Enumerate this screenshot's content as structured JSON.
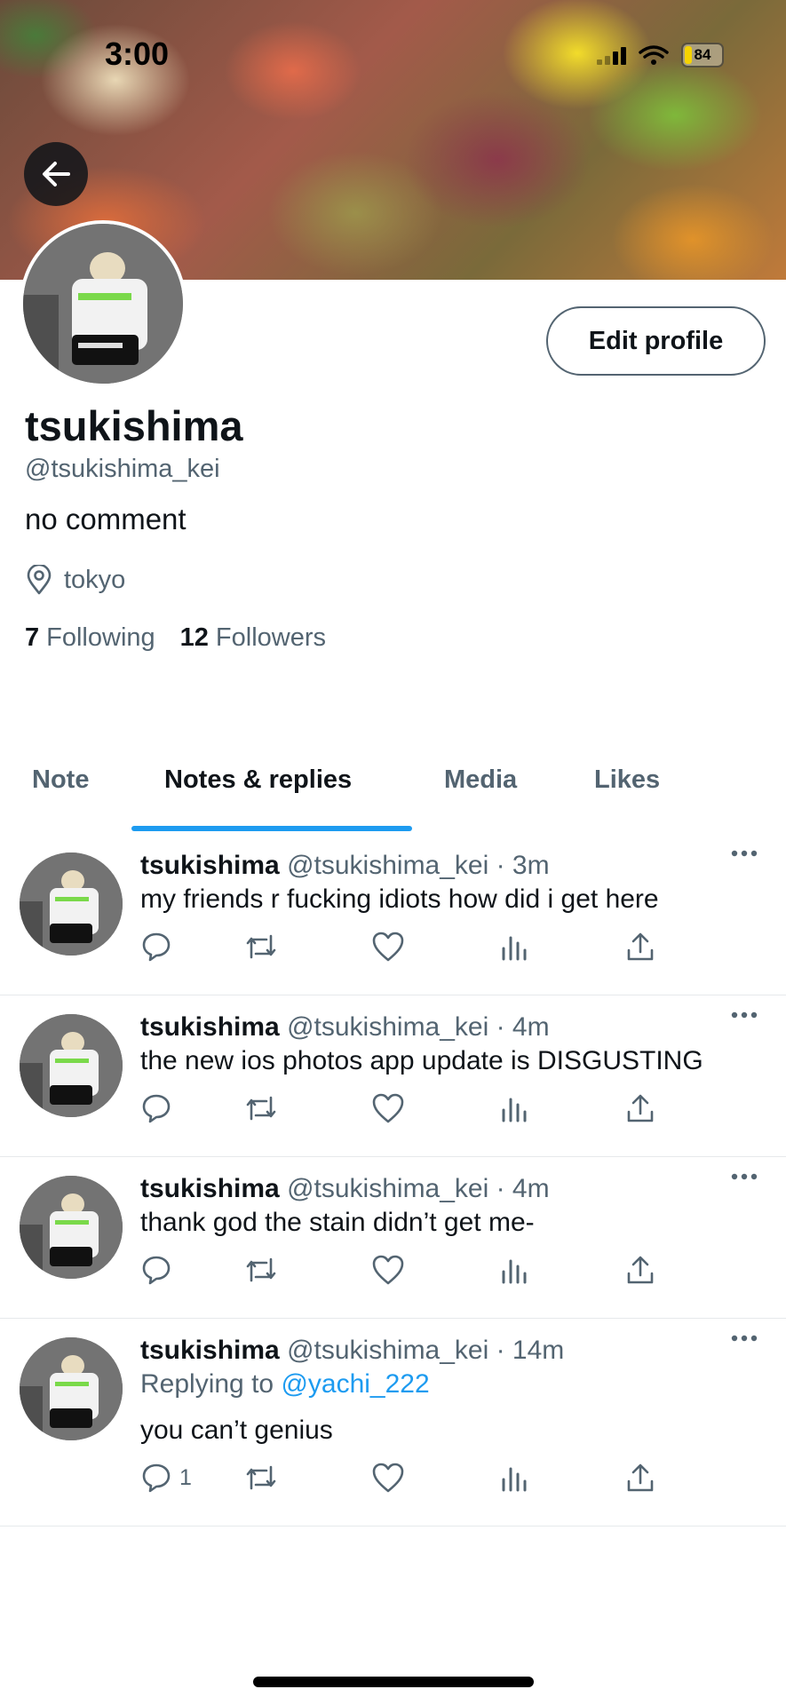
{
  "status_bar": {
    "time": "3:00",
    "battery": "84"
  },
  "profile": {
    "display_name": "tsukishima",
    "handle": "@tsukishima_kei",
    "bio": "no comment",
    "location": "tokyo",
    "following_count": "7",
    "following_label": "Following",
    "followers_count": "12",
    "followers_label": "Followers",
    "edit_profile_label": "Edit profile"
  },
  "tabs": [
    {
      "label": "Note",
      "active": false
    },
    {
      "label": "Notes & replies",
      "active": true
    },
    {
      "label": "Media",
      "active": false
    },
    {
      "label": "Likes",
      "active": false
    }
  ],
  "tweets": [
    {
      "name": "tsukishima",
      "meta": "@tsukishima_kei · 3m",
      "replying_prefix": "",
      "replying_to": "",
      "text": "my friends r fucking idiots how did i get here",
      "reply_count": ""
    },
    {
      "name": "tsukishima",
      "meta": "@tsukishima_kei · 4m",
      "replying_prefix": "",
      "replying_to": "",
      "text": "the new ios photos app update is DISGUSTING",
      "reply_count": ""
    },
    {
      "name": "tsukishima",
      "meta": "@tsukishima_kei · 4m",
      "replying_prefix": "",
      "replying_to": "",
      "text": "thank god the stain didn’t get me-",
      "reply_count": ""
    },
    {
      "name": "tsukishima",
      "meta": "@tsukishima_kei · 14m",
      "replying_prefix": "Replying to",
      "replying_to": "@yachi_222",
      "text": "you can’t genius",
      "reply_count": "1"
    }
  ],
  "icons": {
    "back": "arrow-left-icon",
    "location": "location-pin-icon",
    "more": "more-dots-icon",
    "reply": "reply-icon",
    "retweet": "retweet-icon",
    "like": "heart-icon",
    "views": "views-chart-icon",
    "share": "share-icon"
  },
  "colors": {
    "accent": "#1d9bf0",
    "text": "#0f1419",
    "secondary": "#536471"
  }
}
